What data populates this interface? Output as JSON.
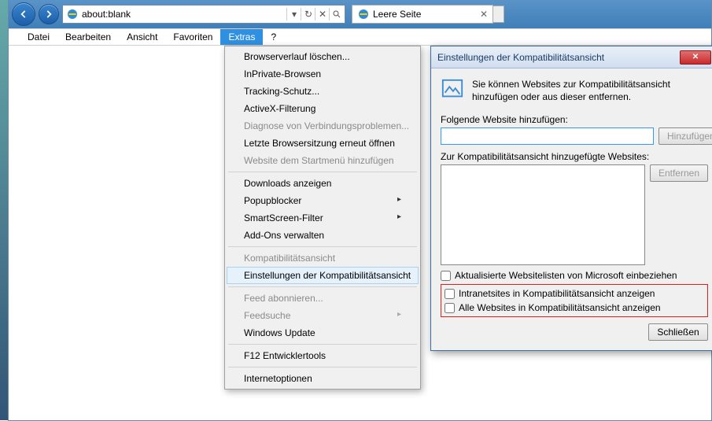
{
  "nav": {
    "url": "about:blank"
  },
  "tab": {
    "title": "Leere Seite"
  },
  "menubar": {
    "items": [
      "Datei",
      "Bearbeiten",
      "Ansicht",
      "Favoriten",
      "Extras",
      "?"
    ],
    "active_index": 4
  },
  "extras_menu": {
    "items": [
      {
        "label": "Browserverlauf löschen...",
        "type": "item"
      },
      {
        "label": "InPrivate-Browsen",
        "type": "item"
      },
      {
        "label": "Tracking-Schutz...",
        "type": "item"
      },
      {
        "label": "ActiveX-Filterung",
        "type": "item"
      },
      {
        "label": "Diagnose von Verbindungsproblemen...",
        "type": "item",
        "disabled": true
      },
      {
        "label": "Letzte Browsersitzung erneut öffnen",
        "type": "item"
      },
      {
        "label": "Website dem Startmenü hinzufügen",
        "type": "item",
        "disabled": true
      },
      {
        "type": "sep"
      },
      {
        "label": "Downloads anzeigen",
        "type": "item"
      },
      {
        "label": "Popupblocker",
        "type": "item",
        "arrow": true
      },
      {
        "label": "SmartScreen-Filter",
        "type": "item",
        "arrow": true
      },
      {
        "label": "Add-Ons verwalten",
        "type": "item"
      },
      {
        "type": "sep"
      },
      {
        "label": "Kompatibilitätsansicht",
        "type": "item",
        "disabled": true
      },
      {
        "label": "Einstellungen der Kompatibilitätsansicht",
        "type": "item",
        "highlight": true
      },
      {
        "type": "sep"
      },
      {
        "label": "Feed abonnieren...",
        "type": "item",
        "disabled": true
      },
      {
        "label": "Feedsuche",
        "type": "item",
        "disabled": true,
        "arrow": true
      },
      {
        "label": "Windows Update",
        "type": "item"
      },
      {
        "type": "sep"
      },
      {
        "label": "F12 Entwicklertools",
        "type": "item"
      },
      {
        "type": "sep"
      },
      {
        "label": "Internetoptionen",
        "type": "item"
      }
    ]
  },
  "dialog": {
    "title": "Einstellungen der Kompatibilitätsansicht",
    "info": "Sie können Websites zur Kompatibilitätsansicht hinzufügen oder aus dieser entfernen.",
    "add_label": "Folgende Website hinzufügen:",
    "add_value": "",
    "add_button": "Hinzufügen",
    "list_label": "Zur Kompatibilitätsansicht hinzugefügte Websites:",
    "remove_button": "Entfernen",
    "check_update": "Aktualisierte Websitelisten von Microsoft einbeziehen",
    "check_intranet": "Intranetsites in Kompatibilitätsansicht anzeigen",
    "check_all": "Alle Websites in Kompatibilitätsansicht anzeigen",
    "close_button": "Schließen"
  }
}
